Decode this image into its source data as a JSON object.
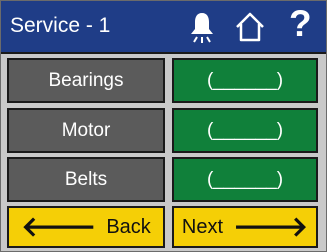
{
  "header": {
    "title": "Service - 1",
    "icons": [
      "bell-icon",
      "home-icon",
      "help-icon"
    ],
    "help_glyph": "?"
  },
  "items": [
    {
      "label": "Bearings",
      "value": "(______)"
    },
    {
      "label": "Motor",
      "value": "(______)"
    },
    {
      "label": "Belts",
      "value": "(______)"
    }
  ],
  "nav": {
    "back_label": "Back",
    "next_label": "Next",
    "back_arrow": "🡐",
    "next_arrow": "🡒"
  },
  "colors": {
    "header": "#1f3d87",
    "label_button": "#5b5b5b",
    "value_button": "#10803a",
    "nav_button": "#f5cf06",
    "background": "#c9c9c9"
  }
}
